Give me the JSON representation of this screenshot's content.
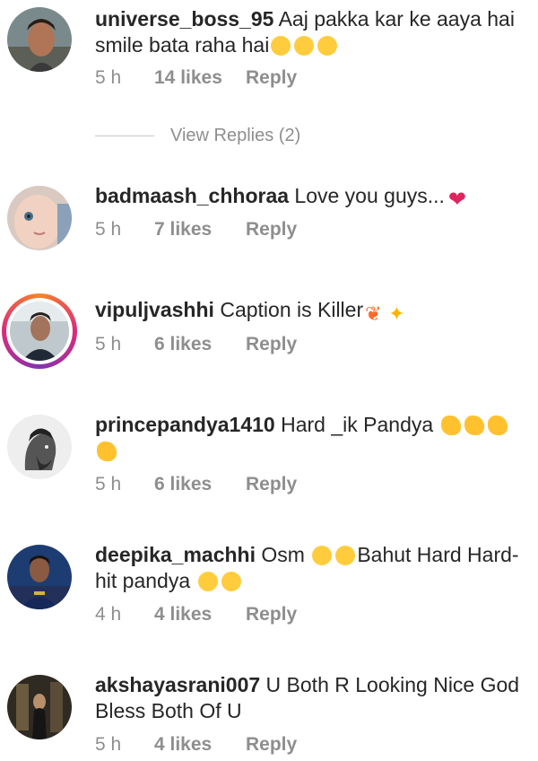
{
  "view_replies_label": "View Replies (2)",
  "comments": [
    {
      "username": "universe_boss_95",
      "text": "Aaj pakka kar ke aaya hai smile bata raha hai",
      "time": "5 h",
      "likes": "14 likes",
      "reply": "Reply"
    },
    {
      "username": "badmaash_chhoraa",
      "text": "Love you guys...",
      "time": "5 h",
      "likes": "7 likes",
      "reply": "Reply"
    },
    {
      "username": "vipuljvashhi",
      "text": "Caption is Killer",
      "time": "5 h",
      "likes": "6 likes",
      "reply": "Reply"
    },
    {
      "username": "princepandya1410",
      "text": "Hard _ik Pandya",
      "time": "5 h",
      "likes": "6 likes",
      "reply": "Reply"
    },
    {
      "username": "deepika_machhi",
      "text_1": "Osm",
      "text_2": "Bahut Hard Hard-hit pandya",
      "time": "4 h",
      "likes": "4 likes",
      "reply": "Reply"
    },
    {
      "username": "akshayasrani007",
      "text": "U Both R Looking Nice God Bless Both Of U",
      "time": "5 h",
      "likes": "4 likes",
      "reply": "Reply"
    }
  ],
  "colors": {
    "text": "#262626",
    "muted": "#8e8e8e",
    "heart": "#e0245e",
    "story_ring": "#dd2a7b"
  },
  "icons": [
    "grinning-emoji",
    "heart-emoji",
    "tulip-emoji",
    "sparkles-emoji",
    "flexed-biceps-emoji",
    "kissing-emoji",
    "heart-eyes-emoji"
  ]
}
